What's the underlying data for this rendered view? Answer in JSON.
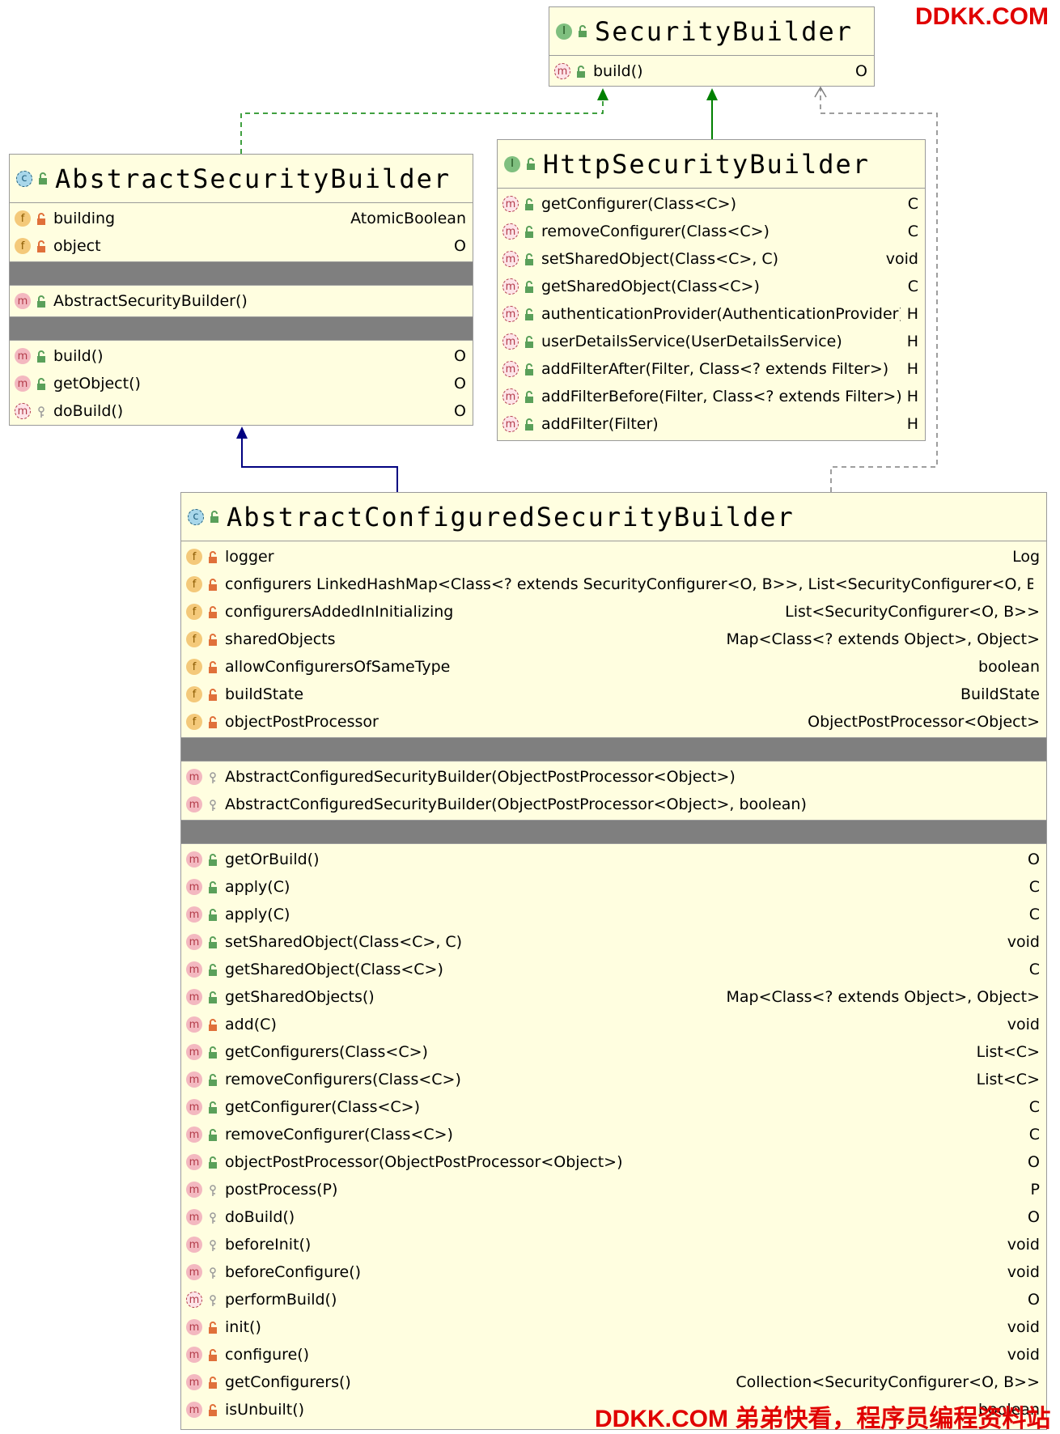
{
  "watermark_top": "DDKK.COM",
  "watermark_bottom": "DDKK.COM 弟弟快看，程序员编程资料站",
  "security_builder": {
    "title": "SecurityBuilder",
    "methods": [
      {
        "label": "build()",
        "type": "O"
      }
    ]
  },
  "http_security_builder": {
    "title": "HttpSecurityBuilder",
    "methods": [
      {
        "label": "getConfigurer(Class<C>)",
        "type": "C"
      },
      {
        "label": "removeConfigurer(Class<C>)",
        "type": "C"
      },
      {
        "label": "setSharedObject(Class<C>, C)",
        "type": "void"
      },
      {
        "label": "getSharedObject(Class<C>)",
        "type": "C"
      },
      {
        "label": "authenticationProvider(AuthenticationProvider)",
        "type": "H"
      },
      {
        "label": "userDetailsService(UserDetailsService)",
        "type": "H"
      },
      {
        "label": "addFilterAfter(Filter, Class<? extends Filter>)",
        "type": "H"
      },
      {
        "label": "addFilterBefore(Filter, Class<? extends Filter>)",
        "type": "H"
      },
      {
        "label": "addFilter(Filter)",
        "type": "H"
      }
    ]
  },
  "abstract_security_builder": {
    "title": "AbstractSecurityBuilder",
    "fields": [
      {
        "label": "building",
        "type": "AtomicBoolean"
      },
      {
        "label": "object",
        "type": "O"
      }
    ],
    "constructors": [
      {
        "label": "AbstractSecurityBuilder()",
        "type": ""
      }
    ],
    "methods": [
      {
        "label": "build()",
        "type": "O"
      },
      {
        "label": "getObject()",
        "type": "O"
      },
      {
        "label": "doBuild()",
        "type": "O"
      }
    ]
  },
  "abstract_configured_security_builder": {
    "title": "AbstractConfiguredSecurityBuilder",
    "fields": [
      {
        "label": "logger",
        "type": "Log"
      },
      {
        "label": "configurers LinkedHashMap<Class<? extends SecurityConfigurer<O, B>>, List<SecurityConfigurer<O, B>>>",
        "type": ""
      },
      {
        "label": "configurersAddedInInitializing",
        "type": "List<SecurityConfigurer<O, B>>"
      },
      {
        "label": "sharedObjects",
        "type": "Map<Class<? extends Object>, Object>"
      },
      {
        "label": "allowConfigurersOfSameType",
        "type": "boolean"
      },
      {
        "label": "buildState",
        "type": "BuildState"
      },
      {
        "label": "objectPostProcessor",
        "type": "ObjectPostProcessor<Object>"
      }
    ],
    "constructors": [
      {
        "label": "AbstractConfiguredSecurityBuilder(ObjectPostProcessor<Object>)",
        "type": ""
      },
      {
        "label": "AbstractConfiguredSecurityBuilder(ObjectPostProcessor<Object>, boolean)",
        "type": ""
      }
    ],
    "methods": [
      {
        "label": "getOrBuild()",
        "type": "O"
      },
      {
        "label": "apply(C)",
        "type": "C"
      },
      {
        "label": "apply(C)",
        "type": "C"
      },
      {
        "label": "setSharedObject(Class<C>, C)",
        "type": "void"
      },
      {
        "label": "getSharedObject(Class<C>)",
        "type": "C"
      },
      {
        "label": "getSharedObjects()",
        "type": "Map<Class<? extends Object>, Object>"
      },
      {
        "label": "add(C)",
        "type": "void"
      },
      {
        "label": "getConfigurers(Class<C>)",
        "type": "List<C>"
      },
      {
        "label": "removeConfigurers(Class<C>)",
        "type": "List<C>"
      },
      {
        "label": "getConfigurer(Class<C>)",
        "type": "C"
      },
      {
        "label": "removeConfigurer(Class<C>)",
        "type": "C"
      },
      {
        "label": "objectPostProcessor(ObjectPostProcessor<Object>)",
        "type": "O"
      },
      {
        "label": "postProcess(P)",
        "type": "P"
      },
      {
        "label": "doBuild()",
        "type": "O"
      },
      {
        "label": "beforeInit()",
        "type": "void"
      },
      {
        "label": "beforeConfigure()",
        "type": "void"
      },
      {
        "label": "performBuild()",
        "type": "O"
      },
      {
        "label": "init()",
        "type": "void"
      },
      {
        "label": "configure()",
        "type": "void"
      },
      {
        "label": "getConfigurers()",
        "type": "Collection<SecurityConfigurer<O, B>>"
      },
      {
        "label": "isUnbuilt()",
        "type": "boolean"
      }
    ]
  },
  "colors": {
    "box_bg": "#fffee0",
    "separator": "#7f7f7f",
    "realization": "#008000",
    "inheritance": "#000080",
    "dashed": "#7f7f7f",
    "watermark": "#e00000"
  }
}
